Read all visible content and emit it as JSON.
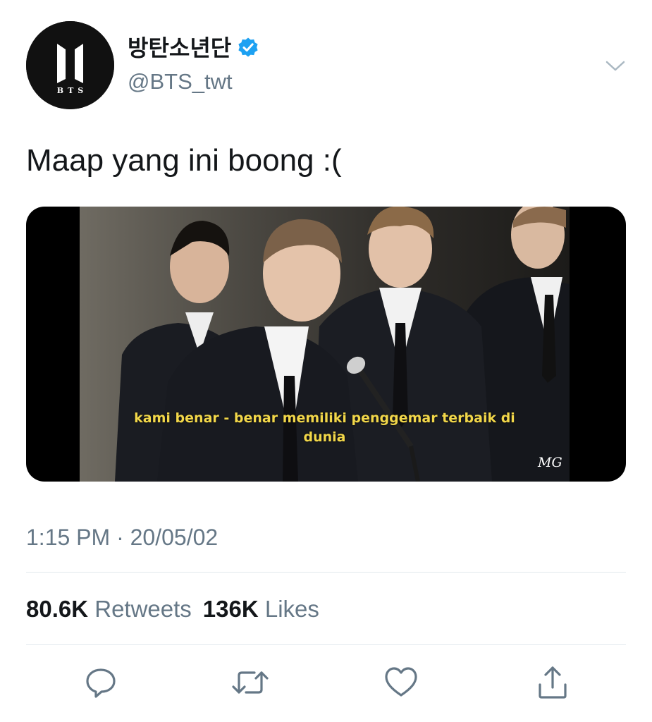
{
  "user": {
    "avatar_text": "BTS",
    "display_name": "방탄소년단",
    "handle": "@BTS_twt",
    "verified": true
  },
  "tweet": {
    "text": "Maap yang ini boong :(",
    "media": {
      "subtitle_line1": "kami benar - benar memiliki penggemar terbaik di",
      "subtitle_line2": "dunia",
      "watermark": "MG"
    },
    "time": "1:15 PM",
    "separator": "·",
    "date": "20/05/02"
  },
  "stats": {
    "retweets_count": "80.6K",
    "retweets_label": "Retweets",
    "likes_count": "136K",
    "likes_label": "Likes"
  },
  "actions": [
    "reply-icon",
    "retweet-icon",
    "like-icon",
    "share-icon"
  ],
  "colors": {
    "text": "#14171a",
    "secondary": "#657786",
    "verified": "#1da1f2",
    "subtitle": "#f2d74a",
    "divider": "#e1e8ed"
  }
}
